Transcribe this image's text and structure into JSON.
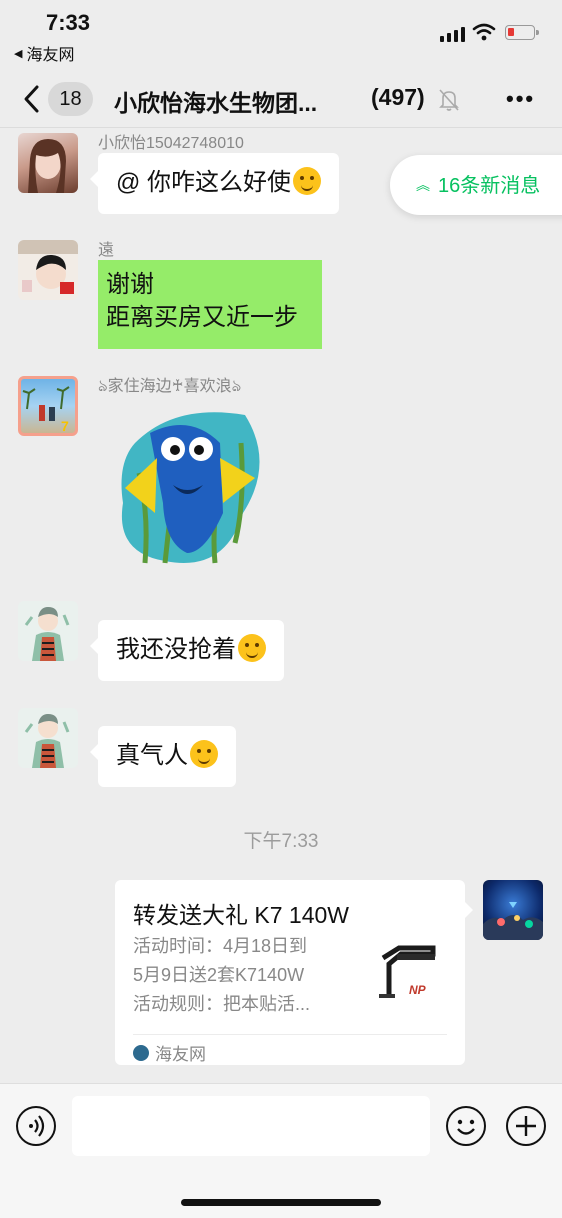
{
  "status_bar": {
    "time": "7:33",
    "back_app": "海友网",
    "battery_color": "#e53935"
  },
  "nav": {
    "unread_badge": "18",
    "title": "小欣怡海水生物团...",
    "member_count": "(497)",
    "mute_icon": "bell-slash-icon",
    "more_icon": "more-dots-icon"
  },
  "new_messages_pill": "16条新消息",
  "messages": [
    {
      "sender": "小欣怡15042748010",
      "text": "@ 你咋这么好使",
      "emoji": "laughing-tears-emoji"
    },
    {
      "sender": "遠",
      "lines": [
        "谢谢",
        "距离买房又近一步"
      ]
    },
    {
      "sender": "ঌ家住海边♰喜欢浪ঌ",
      "sticker": "dory-fish-sticker"
    },
    {
      "sender": "",
      "text": "我还没抢着",
      "emoji": "shocked-emoji"
    },
    {
      "sender": "",
      "text": "真气人",
      "emoji": "crying-emoji"
    }
  ],
  "timestamp": "下午7:33",
  "link_card": {
    "title": "转发送大礼 K7 140W",
    "desc_lines": [
      "活动时间：4月18日到",
      "5月9日送2套K7140W",
      "活动规则：把本贴活..."
    ],
    "thumb_label": "NP",
    "source": "海友网"
  },
  "colors": {
    "accent": "#07c160",
    "bubble_green": "#95ec69",
    "background": "#ededed"
  }
}
